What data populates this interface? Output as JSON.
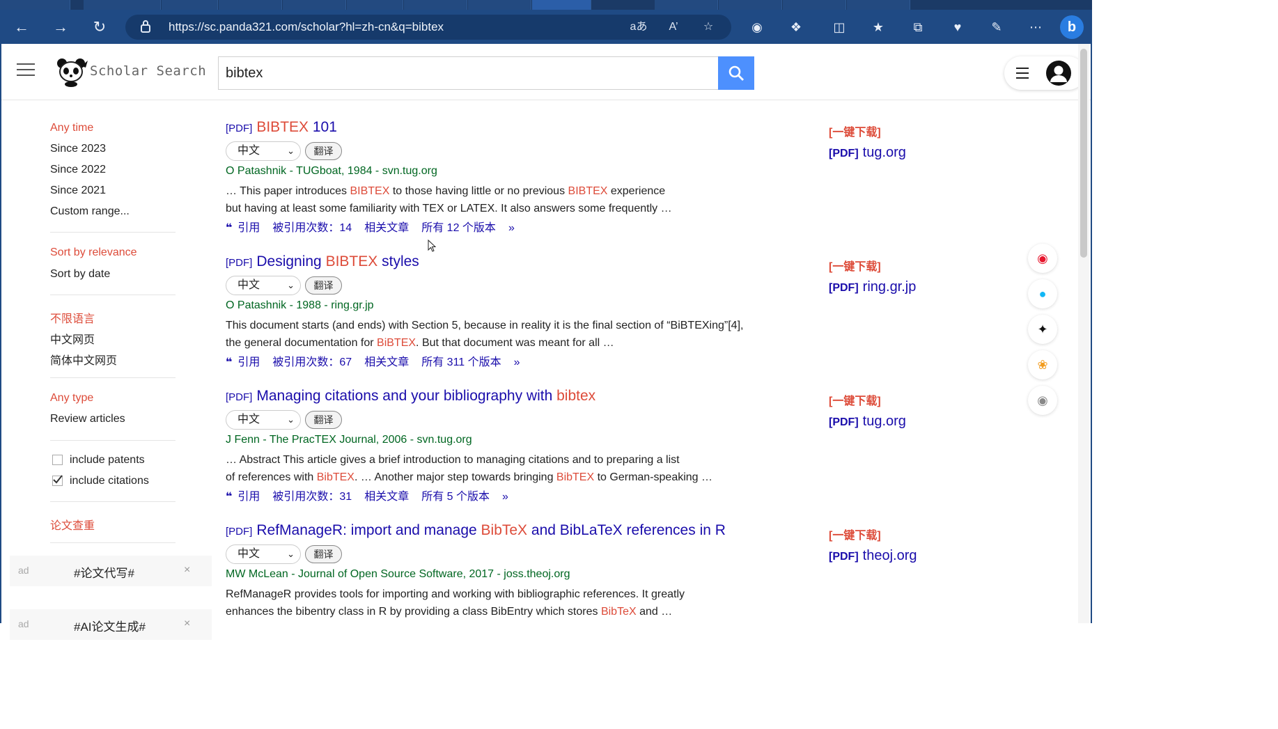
{
  "browser": {
    "url": "https://sc.panda321.com/scholar?hl=zh-cn&q=bibtex"
  },
  "site": {
    "logo_text": "Scholar Search",
    "search_value": "bibtex"
  },
  "sidebar": {
    "time": [
      "Any time",
      "Since 2023",
      "Since 2022",
      "Since 2021",
      "Custom range..."
    ],
    "sort": [
      "Sort by relevance",
      "Sort by date"
    ],
    "language": [
      "不限语言",
      "中文网页",
      "简体中文网页"
    ],
    "type": [
      "Any type",
      "Review articles"
    ],
    "include_patents": "include patents",
    "include_citations": "include citations",
    "plagiarism": "论文查重",
    "ads": [
      {
        "tag": "ad",
        "text": "#论文代写#",
        "close": "×"
      },
      {
        "tag": "ad",
        "text": "#AI论文生成#",
        "close": "×"
      }
    ]
  },
  "common": {
    "pdf_tag": "[PDF]",
    "lang_option": "中文",
    "translate": "翻译",
    "cite": "引用",
    "related": "相关文章",
    "download": "[一键下载]"
  },
  "results": [
    {
      "title_pre": "",
      "title_hl": "BIBTEX",
      "title_post": " 101",
      "meta": "O Patashnik - TUGboat, 1984 - svn.tug.org",
      "snippet_line1_pre": "… This paper introduces ",
      "snippet_line1_hl1": "BIBTEX",
      "snippet_line1_mid": " to those having little or no previous ",
      "snippet_line1_hl2": "BIBTEX",
      "snippet_line1_post": " experience",
      "snippet_line2": "but having at least some familiarity with TEX or LATEX. It also answers some frequently …",
      "cited_by": "被引用次数：14",
      "versions": "所有 12 个版本",
      "source": "tug.org"
    },
    {
      "title_pre": "Designing ",
      "title_hl": "BIBTEX",
      "title_post": " styles",
      "meta": "O Patashnik - 1988 - ring.gr.jp",
      "snippet_line1_pre": "This document starts (and ends) with Section 5, because in reality it is the final section of “BiBTEXing”[4],",
      "snippet_line2_pre": "the general documentation for ",
      "snippet_line2_hl": "BiBTEX",
      "snippet_line2_post": ". But that document was meant for all …",
      "cited_by": "被引用次数：67",
      "versions": "所有 311 个版本",
      "source": "ring.gr.jp"
    },
    {
      "title_pre": "Managing citations and your bibliography with ",
      "title_hl": "bibtex",
      "title_post": "",
      "meta": "J Fenn - The PracTEX Journal, 2006 - svn.tug.org",
      "snippet_line1_pre": "… Abstract This article gives a brief introduction to managing citations and to preparing a list",
      "snippet_line2_pre": "of references with ",
      "snippet_line2_hl": "BibTEX",
      "snippet_line2_mid": ". … Another major step towards bringing ",
      "snippet_line2_hl2": "BibTEX",
      "snippet_line2_post": " to German-speaking …",
      "cited_by": "被引用次数：31",
      "versions": "所有 5 个版本",
      "source": "tug.org"
    },
    {
      "title_pre": "RefManageR: import and manage ",
      "title_hl": "BibTeX",
      "title_post": " and BibLaTeX references in R",
      "meta": "MW McLean - Journal of Open Source Software, 2017 - joss.theoj.org",
      "snippet_line1_pre": "RefManageR provides tools for importing and working with bibliographic references. It greatly",
      "snippet_line2_pre": "enhances the bibentry class in R by providing a class BibEntry which stores ",
      "snippet_line2_hl": "BibTeX",
      "snippet_line2_post": " and …",
      "source": "theoj.org"
    }
  ],
  "colors": {
    "accent_red": "#dd4b39",
    "link_blue": "#1a0dab",
    "meta_green": "#006621",
    "search_blue": "#4d90fe"
  }
}
